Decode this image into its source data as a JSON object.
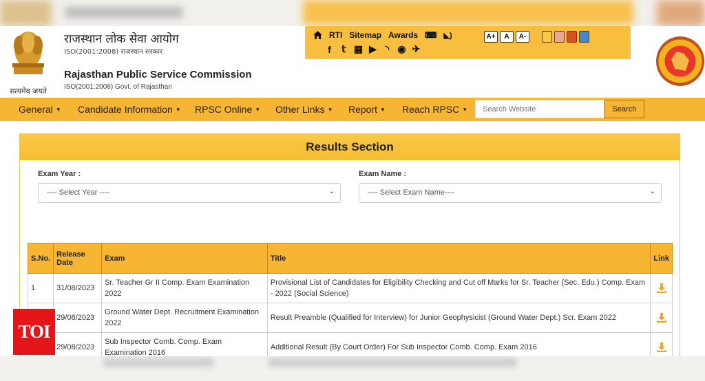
{
  "header": {
    "hindi_title": "राजस्थान लोक सेवा आयोग",
    "hindi_iso": "ISO(2001:2008) राजस्थान सरकार",
    "english_title": "Rajasthan Public Service Commission",
    "english_iso": "ISO(2001:2008) Govt. of Rajasthan",
    "emblem_motto": "सत्यमेव जयते"
  },
  "toolbar": {
    "links": [
      "RTI",
      "Sitemap",
      "Awards"
    ],
    "font_sizes": [
      "A+",
      "A",
      "A-"
    ],
    "theme_colors": [
      "#f9c948",
      "#e8a99b",
      "#d4531f",
      "#4a86c5"
    ],
    "social_icons": [
      "facebook-icon",
      "twitter-icon",
      "calendar-icon",
      "youtube-icon",
      "rss-icon",
      "globe-icon",
      "pin-icon"
    ]
  },
  "nav": {
    "items": [
      "General",
      "Candidate Information",
      "RPSC Online",
      "Other Links",
      "Report",
      "Reach RPSC"
    ],
    "search_placeholder": "Search Website",
    "search_button": "Search"
  },
  "results": {
    "heading": "Results Section",
    "exam_year_label": "Exam Year :",
    "exam_year_value": "---- Select Year ----",
    "exam_name_label": "Exam Name :",
    "exam_name_value": "---- Select Exam Name----",
    "columns": [
      "S.No.",
      "Release Date",
      "Exam",
      "Title",
      "Link"
    ],
    "rows": [
      {
        "sno": "1",
        "date": "31/08/2023",
        "exam": "Sr. Teacher Gr II Comp. Exam Examination 2022",
        "title": "Provisional List of Candidates for Eligibility Checking and Cut off Marks for Sr. Teacher (Sec. Edu.) Comp. Exam - 2022 (Social Science)"
      },
      {
        "sno": "",
        "date": "29/08/2023",
        "exam": "Ground Water Dept. Recruitment Examination 2022",
        "title": "Result Preamble (Qualified for Interview) for Junior Geophysicist (Ground Water Dept.) Scr. Exam 2022"
      },
      {
        "sno": "",
        "date": "29/08/2023",
        "exam": "Sub Inspector Comb. Comp. Exam Examination 2016",
        "title": "Additional Result (By Court Order) For Sub Inspector Comb. Comp. Exam 2016"
      }
    ]
  },
  "watermark": "TOI"
}
